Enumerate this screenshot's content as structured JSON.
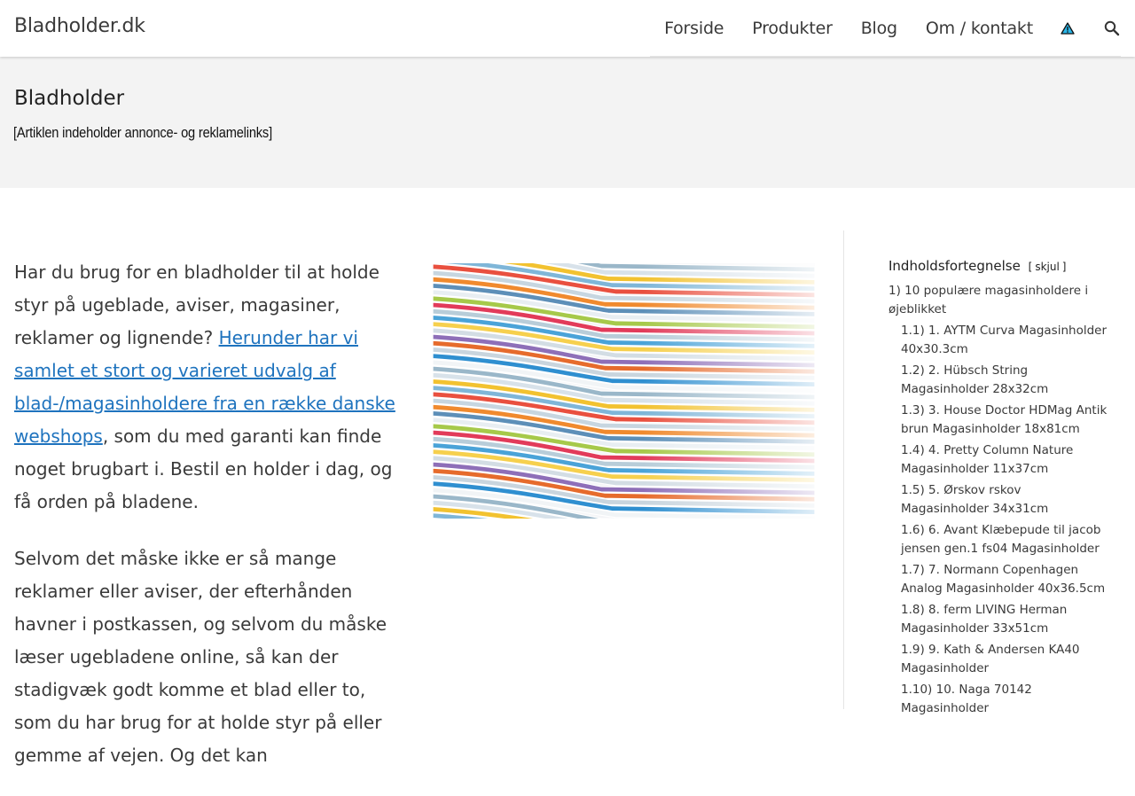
{
  "header": {
    "site_title": "Bladholder.dk",
    "nav": [
      "Forside",
      "Produkter",
      "Blog",
      "Om / kontakt"
    ],
    "icons": {
      "warning": "warning-triangle-icon",
      "search": "search-icon"
    }
  },
  "hero": {
    "title": "Bladholder",
    "disclaimer": "[Artiklen indeholder annonce- og reklamelinks]"
  },
  "article": {
    "p1_before": "Har du brug for en bladholder til at holde styr på ugeblade, aviser, magasiner, reklamer og lignende? ",
    "p1_link": "Herunder har vi samlet et stort og varieret udvalg af blad-/magasinholdere fra en række danske webshops",
    "p1_after": ", som du med garanti kan finde noget brugbart i. Bestil en holder i dag, og få orden på bladene.",
    "p2": "Selvom det måske ikke er så mange reklamer eller aviser, der efterhånden havner i postkassen, og selvom du måske læser ugebladene online, så kan der stadigvæk godt komme et blad eller to, som du har brug for at holde styr på eller gemme af vejen. Og det kan"
  },
  "toc": {
    "title": "Indholdsfortegnelse",
    "toggle": "skjul",
    "items": [
      {
        "num": "1)",
        "text": "10 populære magasinholdere i øjeblikket",
        "level": 1
      },
      {
        "num": "1.1)",
        "text": "1. AYTM Curva Magasinholder 40x30.3cm",
        "level": 2
      },
      {
        "num": "1.2)",
        "text": "2. Hübsch String Magasinholder 28x32cm",
        "level": 2
      },
      {
        "num": "1.3)",
        "text": "3. House Doctor HDMag Antik brun Magasinholder 18x81cm",
        "level": 2
      },
      {
        "num": "1.4)",
        "text": "4. Pretty Column Nature Magasinholder 11x37cm",
        "level": 2
      },
      {
        "num": "1.5)",
        "text": "5. Ørskov rskov Magasinholder 34x31cm",
        "level": 2
      },
      {
        "num": "1.6)",
        "text": "6. Avant Klæbepude til jacob jensen gen.1 fs04 Magasinholder",
        "level": 2
      },
      {
        "num": "1.7)",
        "text": "7. Normann Copenhagen Analog Magasinholder 40x36.5cm",
        "level": 2
      },
      {
        "num": "1.8)",
        "text": "8. ferm LIVING Herman Magasinholder 33x51cm",
        "level": 2
      },
      {
        "num": "1.9)",
        "text": "9. Kath & Andersen KA40 Magasinholder",
        "level": 2
      },
      {
        "num": "1.10)",
        "text": "10. Naga 70142 Magasinholder",
        "level": 2
      }
    ]
  },
  "colors": {
    "link": "#1e73be",
    "hero_bg": "#f3f3f3",
    "text": "#3a3a3a"
  }
}
